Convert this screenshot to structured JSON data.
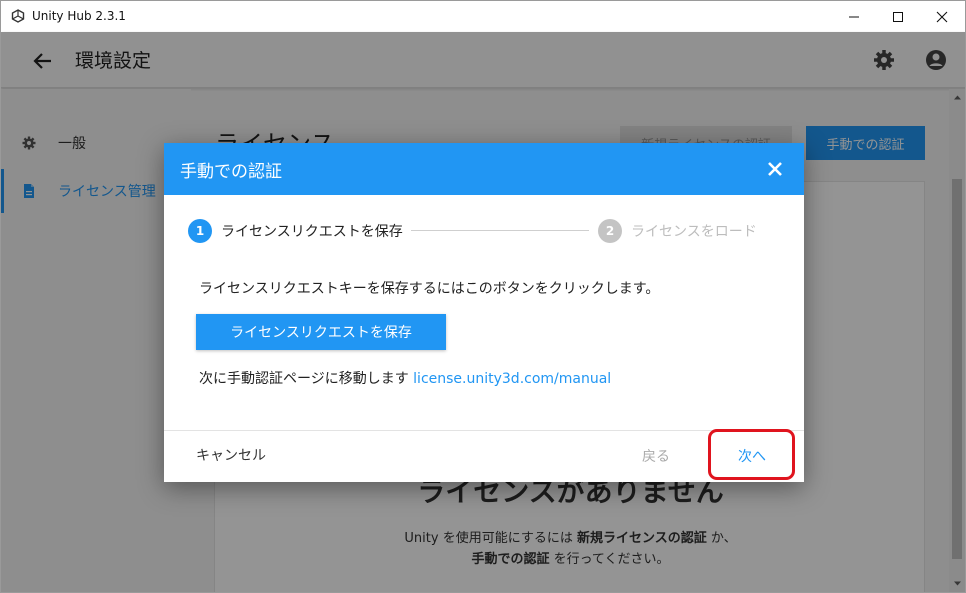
{
  "window": {
    "title": "Unity Hub 2.3.1",
    "minimize_icon": "minimize-icon",
    "maximize_icon": "maximize-icon",
    "close_icon": "close-icon"
  },
  "header": {
    "title": "環境設定",
    "back_icon": "arrow-left-icon",
    "settings_icon": "gear-icon",
    "account_icon": "account-circle-icon"
  },
  "sidebar": {
    "items": [
      {
        "label": "一般",
        "icon": "gear-icon",
        "active": false
      },
      {
        "label": "ライセンス管理",
        "icon": "document-icon",
        "active": true
      }
    ]
  },
  "content": {
    "title": "ライセンス",
    "new_license_button": "新規ライセンスの認証",
    "manual_button": "手動での認証",
    "no_license_heading": "ライセンスがありません",
    "desc_part1": "Unity を使用可能にするには ",
    "desc_bold1": "新規ライセンスの認証",
    "desc_part2": " か、",
    "desc_bold2": "手動での認証",
    "desc_part3": " を行ってください。"
  },
  "modal": {
    "title": "手動での認証",
    "close_icon": "close-icon",
    "steps": [
      {
        "number": "1",
        "label": "ライセンスリクエストを保存",
        "active": true
      },
      {
        "number": "2",
        "label": "ライセンスをロード",
        "active": false
      }
    ],
    "description": "ライセンスリクエストキーを保存するにはこのボタンをクリックします。",
    "save_button": "ライセンスリクエストを保存",
    "next_text": "次に手動認証ページに移動します ",
    "link": "license.unity3d.com/manual",
    "cancel_button": "キャンセル",
    "back_button": "戻る",
    "next_button": "次へ"
  },
  "colors": {
    "accent": "#2196f3",
    "highlight": "#e0141e"
  }
}
